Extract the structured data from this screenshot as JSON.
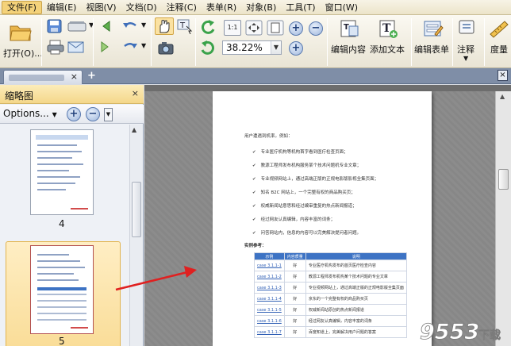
{
  "menu": [
    "文件(F)",
    "编辑(E)",
    "视图(V)",
    "文档(D)",
    "注释(C)",
    "表单(R)",
    "对象(B)",
    "工具(T)",
    "窗口(W)"
  ],
  "toolbar": {
    "open_label": "打开(O)...",
    "zoom_value": "38.22%",
    "edit_content_label": "编辑内容",
    "add_text_label": "添加文本",
    "edit_form_label": "编辑表单",
    "annotate_label": "注释",
    "measure_label": "度量"
  },
  "tab": {
    "close": "×",
    "new": "+"
  },
  "panel": {
    "title": "缩略图",
    "close": "×",
    "options_label": "Options...",
    "zoom_in": "+",
    "zoom_out": "−",
    "thumbnails": [
      {
        "page": "4"
      },
      {
        "page": "5",
        "selected": true
      }
    ]
  },
  "document": {
    "intro": "用户遭遇到机率。例如：",
    "bullets": [
      "专业医疗机构等机构首字看到医疗检查页面；",
      "教源工程师发布机构服务某个技术问题机专业文章；",
      "专业视频网站上，通过高端正版的正规电影版影视全集页面；",
      "知名 B2C 网站上，一个完整有权的商品购买页；",
      "权威新闻站意思和经过编审重复的热点新闻报道；",
      "经过网友认真编辑，内容丰富的词条；",
      "问答网站内，信息的内容可以完美解决提问者问题。"
    ],
    "case_heading": "实例参考：",
    "table": {
      "headers": [
        "示例",
        "内容质量",
        "说明"
      ],
      "rows": [
        {
          "case": "case 3.1.1-1",
          "quality": "好",
          "note": "专业医疗机构发布的首页医疗检查内容"
        },
        {
          "case": "case 3.1.1-2",
          "quality": "好",
          "note": "教源工程师发布机构某个技术问题的专业文章"
        },
        {
          "case": "case 3.1.1-3",
          "quality": "好",
          "note": "专业视频网站上，通过高端正版的正规电影版全集页面"
        },
        {
          "case": "case 3.1.1-4",
          "quality": "好",
          "note": "京东的一个完整有权的商品购买页"
        },
        {
          "case": "case 3.1.1-5",
          "quality": "好",
          "note": "权威新闻站原创的热点新闻报道"
        },
        {
          "case": "case 3.1.1-6",
          "quality": "好",
          "note": "经过网友认真编辑，内容丰富的词条"
        },
        {
          "case": "case 3.1.1-7",
          "quality": "好",
          "note": "百度知道上，完美解决用户问题的答案"
        }
      ]
    }
  },
  "watermark": {
    "text": "9553",
    "sub": "下载"
  },
  "colors": {
    "accent": "#f4d78a",
    "arrow": "#e02020",
    "table_header": "#3d73c4"
  }
}
